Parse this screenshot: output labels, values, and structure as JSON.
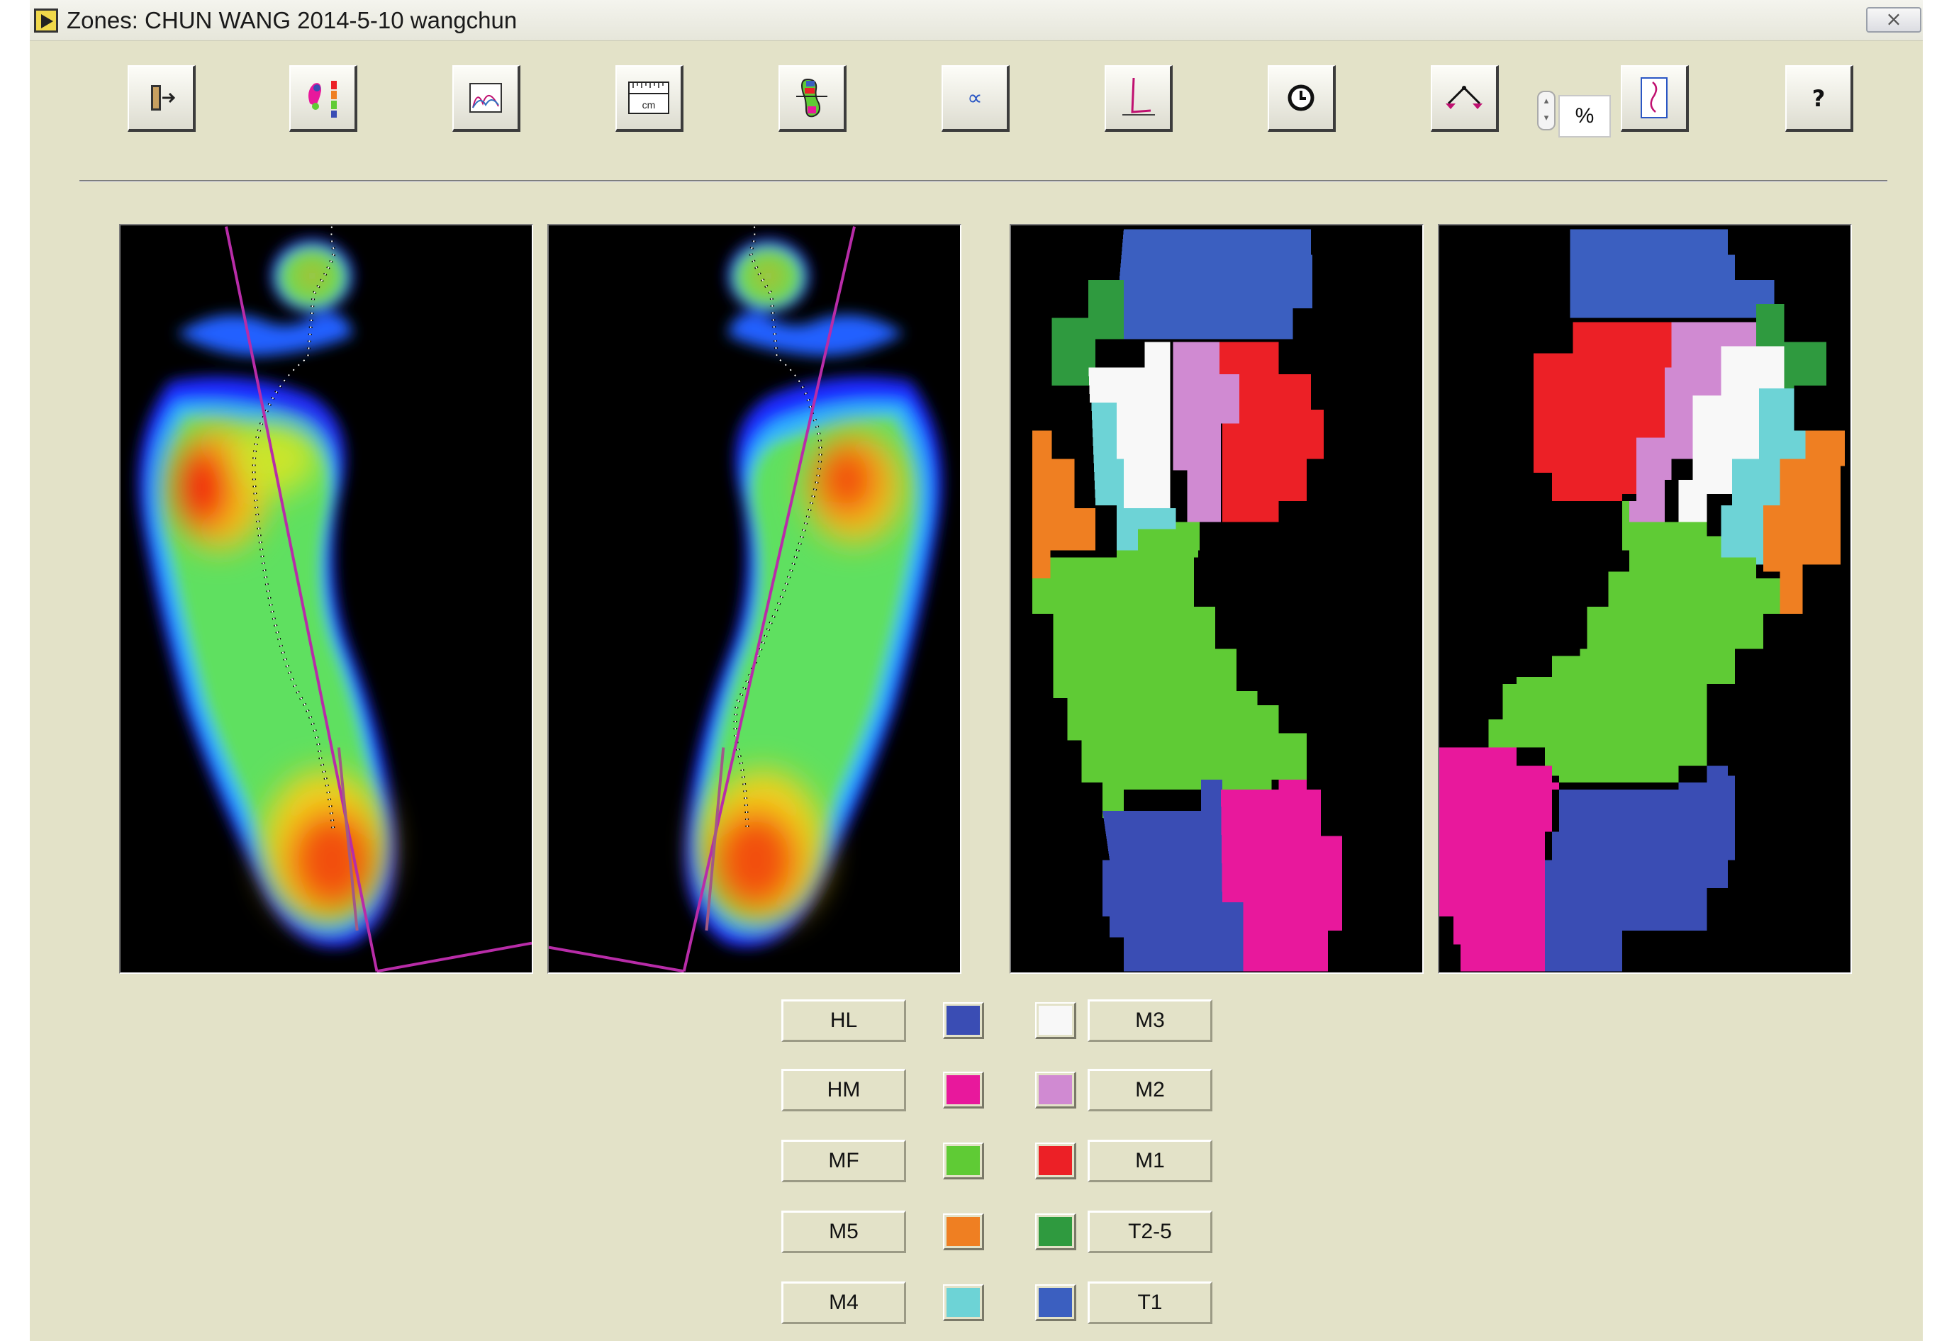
{
  "window": {
    "title": "Zones: CHUN WANG 2014-5-10 wangchun",
    "close_symbol": "⨯"
  },
  "toolbar": {
    "buttons": [
      {
        "name": "exit-icon"
      },
      {
        "name": "foot-pressure-scale-icon"
      },
      {
        "name": "graph-icon"
      },
      {
        "name": "ruler-icon",
        "unit_label": "cm"
      },
      {
        "name": "foot-zones-icon"
      },
      {
        "name": "proportional-icon",
        "symbol": "∝"
      },
      {
        "name": "angle-icon"
      },
      {
        "name": "clock-icon"
      },
      {
        "name": "balance-icon"
      },
      {
        "name": "progression-line-icon"
      },
      {
        "name": "help-icon",
        "symbol": "?"
      }
    ],
    "percent_field": "%",
    "spinner_up": "▴",
    "spinner_down": "▾"
  },
  "panels": [
    {
      "name": "left-foot-pressure-map"
    },
    {
      "name": "right-foot-pressure-map"
    },
    {
      "name": "left-foot-zone-map"
    },
    {
      "name": "right-foot-zone-map"
    }
  ],
  "legend": {
    "left": [
      {
        "label": "HL",
        "color": "#3a4db4"
      },
      {
        "label": "HM",
        "color": "#e8189c"
      },
      {
        "label": "MF",
        "color": "#5fcb35"
      },
      {
        "label": "M5",
        "color": "#ef7f22"
      },
      {
        "label": "M4",
        "color": "#6dd3d6"
      }
    ],
    "right": [
      {
        "label": "M3",
        "color": "#f8f8f8"
      },
      {
        "label": "M2",
        "color": "#d08ad2"
      },
      {
        "label": "M1",
        "color": "#ec2026"
      },
      {
        "label": "T2-5",
        "color": "#2f9a3f"
      },
      {
        "label": "T1",
        "color": "#3b5fc0"
      }
    ]
  }
}
